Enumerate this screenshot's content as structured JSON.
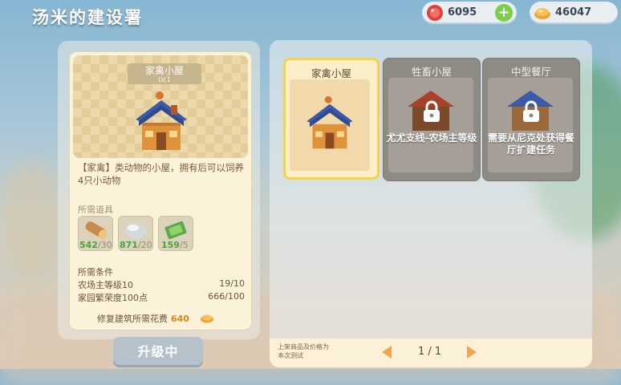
{
  "header": {
    "title": "汤米的建设署",
    "currency_gem": "6095",
    "currency_coin": "46047",
    "gem_icon": "red-gem-icon",
    "coin_icon": "gold-coin-icon"
  },
  "detail": {
    "building_name": "家禽小屋",
    "level": "LV.1",
    "description": "【家禽】类动物的小屋，拥有后可以饲养4只小动物",
    "materials_label": "所需道具",
    "materials": [
      {
        "icon": "wood-log-icon",
        "have": "542",
        "need": "/30"
      },
      {
        "icon": "stone-icon",
        "have": "871",
        "need": "/20"
      },
      {
        "icon": "cash-bundle-icon",
        "have": "159",
        "need": "/5"
      }
    ],
    "conditions_label": "所需条件",
    "conditions": [
      {
        "label": "农场主等级10",
        "value": "19/10"
      },
      {
        "label": "家园繁荣度100点",
        "value": "666/100"
      }
    ],
    "cost_label": "修复建筑所需花费",
    "cost_value": "640",
    "upgrade_button": "升级中"
  },
  "slots": [
    {
      "name": "家禽小屋",
      "selected": true,
      "locked": false,
      "lock_text": ""
    },
    {
      "name": "牲畜小屋",
      "selected": false,
      "locked": true,
      "lock_text": "尤尤支线-农场主等级"
    },
    {
      "name": "中型餐厅",
      "selected": false,
      "locked": true,
      "lock_text": "需要从尼克处获得餐厅扩建任务"
    }
  ],
  "footer": {
    "note": "上架商品及价格为本次测试",
    "page": "1 / 1"
  },
  "colors": {
    "accent": "#f6d24a",
    "have_green": "#49a43b",
    "cost_orange": "#d88a12"
  }
}
